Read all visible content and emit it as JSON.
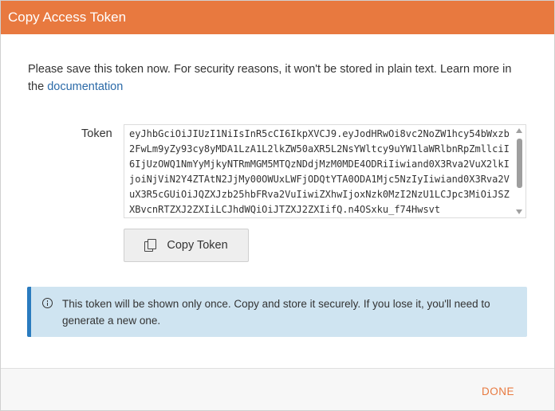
{
  "dialog": {
    "title": "Copy Access Token",
    "intro_text": "Please save this token now. For security reasons, it won't be stored in plain text. Learn more in the ",
    "intro_link": "documentation",
    "token_label": "Token",
    "token_value": "eyJhbGciOiJIUzI1NiIsInR5cCI6IkpXVCJ9.eyJodHRwOi8vc2NoZW1hcy54bWxzb2FwLm9yZy93cy8yMDA1LzA1L2lkZW50aXR5L2NsYWltcy9uYW1laWRlbnRpZmllciI6IjUzOWQ1NmYyMjkyNTRmMGM5MTQzNDdjMzM0MDE4ODRiIiwiand0X3Rva2VuX2lkIjoiNjViN2Y4ZTAtN2JjMy00OWUxLWFjODQtYTA0ODA1Mjc5NzIyIiwiand0X3Rva2VuX3R5cGUiOiJQZXJzb25hbFRva2VuIiwiZXhwIjoxNzk0MzI2NzU1LCJpc3MiOiJSZXBvcnRTZXJ2ZXIiLCJhdWQiOiJTZXJ2ZXIifQ.n4OSxku_f74Hwsvt",
    "copy_button_label": "Copy Token",
    "info_text": "This token will be shown only once. Copy and store it securely. If you lose it, you'll need to generate a new one.",
    "done_label": "DONE"
  },
  "colors": {
    "accent": "#e8793f",
    "info_background": "#cfe4f1",
    "info_border": "#2a7bbf",
    "link": "#2b6aa8"
  },
  "icons": {
    "copy_button": "copy-icon",
    "info": "info-icon"
  }
}
